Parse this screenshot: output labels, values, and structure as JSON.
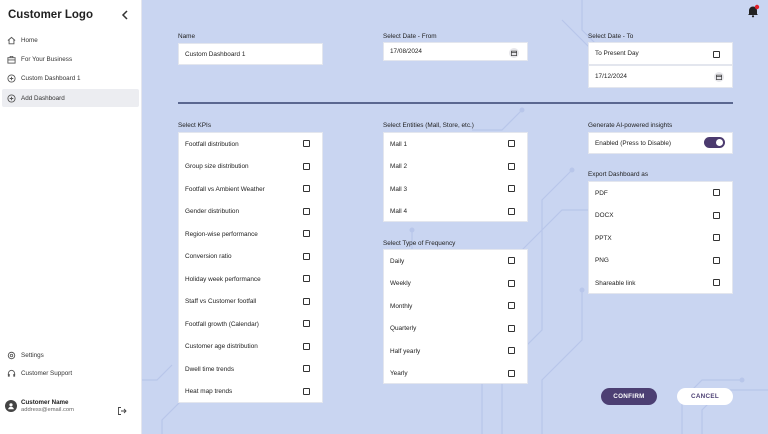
{
  "sidebar": {
    "logo": "Customer Logo",
    "nav": [
      {
        "label": "Home",
        "icon": "home-icon"
      },
      {
        "label": "For Your Business",
        "icon": "briefcase-icon"
      },
      {
        "label": "Custom Dashboard 1",
        "icon": "plus-circle-icon"
      },
      {
        "label": "Add Dashboard",
        "icon": "plus-circle-icon"
      }
    ],
    "footer_nav": [
      {
        "label": "Settings",
        "icon": "gear-icon"
      },
      {
        "label": "Customer Support",
        "icon": "headset-icon"
      }
    ],
    "user": {
      "name": "Customer Name",
      "email": "address@email.com"
    }
  },
  "form": {
    "name": {
      "label": "Name",
      "value": "Custom Dashboard 1"
    },
    "date_from": {
      "label": "Select Date - From",
      "value": "17/08/2024"
    },
    "date_to": {
      "label": "Select Date - To",
      "present_label": "To Present Day",
      "value": "17/12/2024"
    },
    "kpis": {
      "label": "Select KPIs",
      "items": [
        "Footfall distribution",
        "Group size distribution",
        "Footfall vs Ambient Weather",
        "Gender distribution",
        "Region-wise performance",
        "Conversion ratio",
        "Holiday week performance",
        "Staff vs Customer footfall",
        "Footfall growth (Calendar)",
        "Customer age distribution",
        "Dwell time trends",
        "Heat map trends"
      ]
    },
    "entities": {
      "label": "Select Entities (Mall, Store, etc.)",
      "items": [
        "Mall 1",
        "Mall 2",
        "Mall 3",
        "Mall 4"
      ]
    },
    "frequency": {
      "label": "Select Type of Frequency",
      "items": [
        "Daily",
        "Weekly",
        "Monthly",
        "Quarterly",
        "Half yearly",
        "Yearly"
      ]
    },
    "ai": {
      "label": "Generate AI-powered insights",
      "value": "Enabled (Press to Disable)"
    },
    "export": {
      "label": "Export Dashboard as",
      "items": [
        "PDF",
        "DOCX",
        "PPTX",
        "PNG",
        "Shareable link"
      ]
    },
    "confirm_label": "CONFIRM",
    "cancel_label": "CANCEL"
  },
  "colors": {
    "accent": "#4c3f73",
    "background": "#c9d5f1",
    "notification": "#e0202a"
  }
}
